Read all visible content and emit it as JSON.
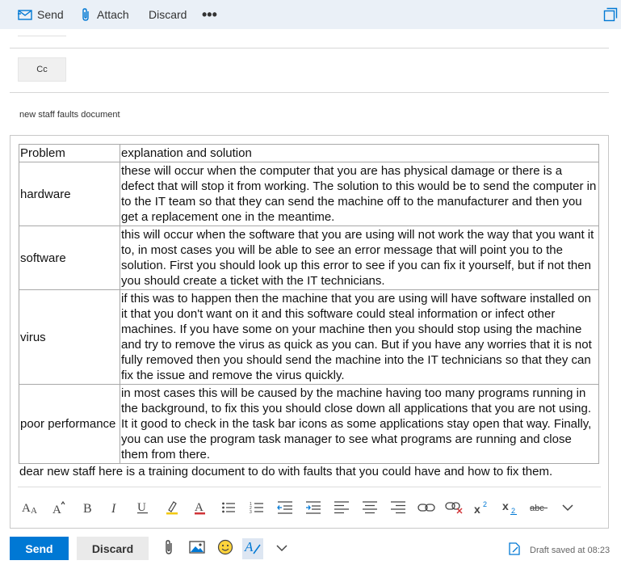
{
  "toolbar": {
    "send_label": "Send",
    "attach_label": "Attach",
    "discard_label": "Discard",
    "more_label": "•••",
    "popout_icon": "popout-icon"
  },
  "cc": {
    "label": "Cc"
  },
  "subject": {
    "text": "new staff faults document"
  },
  "table": {
    "header": [
      "Problem",
      "explanation and solution"
    ],
    "rows": [
      {
        "problem": "hardware",
        "text": "these will occur when the computer that you are has physical damage or there is a defect that will stop it from working. The solution to this would be to send the computer in to the IT team so that they can send the machine off to the manufacturer and then you get a replacement one in the meantime."
      },
      {
        "problem": "software",
        "text": "this will occur when the software that you are using will not work the way that you want it to, in most cases you will be able to see an error message that will point you to the solution. First you should look up this error to see if you can fix it yourself, but if not then you should create a ticket with the IT technicians."
      },
      {
        "problem": "virus",
        "text": "if this was to happen then the machine that you are using will have software installed on it that you don't want on it and this software could steal information or infect other machines. If you have some on your machine then you should stop using the machine and try to remove the virus as quick as you can. But if you have any worries that it is not fully removed then you should send the machine into the IT technicians so that they can fix the issue and remove the virus quickly."
      },
      {
        "problem": "poor performance",
        "text": "in most cases this will be caused by the machine having too many programs running in the background, to fix this you should close down all applications that you are not using. It it good to check in the task bar icons as some applications stay open that way. Finally, you can use the program task manager to see what programs are running and close them from there."
      }
    ]
  },
  "intro": {
    "text": "dear new staff here is a training document to do with faults that you could have and how to fix them."
  },
  "format_toolbar": {
    "icons": [
      "font-size-icon",
      "font-grow-icon",
      "bold-icon",
      "italic-icon",
      "underline-icon",
      "highlight-icon",
      "font-color-icon",
      "bullets-icon",
      "numbering-icon",
      "outdent-icon",
      "indent-icon",
      "align-left-icon",
      "align-center-icon",
      "align-right-icon",
      "link-icon",
      "remove-link-icon",
      "superscript-icon",
      "subscript-icon",
      "strikethrough-icon",
      "more-formatting-icon"
    ],
    "highlight_color": "#f2c811",
    "font_color": "#d13438",
    "accent_color": "#0078d4"
  },
  "footer": {
    "send_label": "Send",
    "discard_label": "Discard",
    "draft_status": "Draft saved at 08:23",
    "icons": [
      "attach-icon",
      "image-icon",
      "emoji-icon",
      "format-text-icon",
      "more-options-icon",
      "draft-icon"
    ]
  }
}
